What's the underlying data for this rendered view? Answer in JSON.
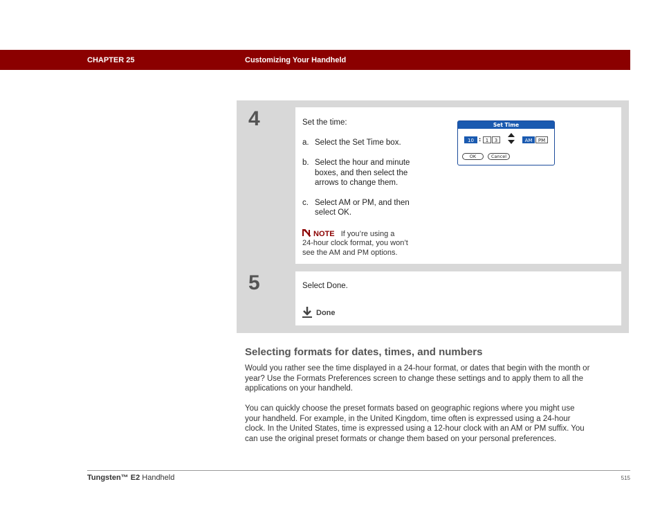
{
  "header": {
    "chapter": "CHAPTER 25",
    "title": "Customizing Your Handheld"
  },
  "step4": {
    "number": "4",
    "intro": "Set the time:",
    "a_prefix": "a.",
    "a_text": "Select the Set Time box.",
    "b_prefix": "b.",
    "b_line1": "Select the hour and minute",
    "b_line2": "boxes, and then select the",
    "b_line3": "arrows to change them.",
    "c_prefix": "c.",
    "c_line1": "Select AM or PM, and then",
    "c_line2": "select OK.",
    "note_label": "NOTE",
    "note_line1": "If you’re using a",
    "note_line2": "24-hour clock format, you won’t",
    "note_line3": "see the AM and PM options.",
    "dialog": {
      "title": "Set Time",
      "hour": "10",
      "separator": ":",
      "minute_tens": "1",
      "minute_ones": "3",
      "am": "AM",
      "pm": "PM",
      "ok": "OK",
      "cancel": "Cancel"
    }
  },
  "step5": {
    "number": "5",
    "text": "Select Done.",
    "done_label": "Done"
  },
  "section": {
    "title": "Selecting formats for dates, times, and numbers",
    "p1_l1": "Would you rather see the time displayed in a 24-hour format, or dates that begin with the month or",
    "p1_l2": "year? Use the Formats Preferences screen to change these settings and to apply them to all the",
    "p1_l3": "applications on your handheld.",
    "p2_l1": "You can quickly choose the preset formats based on geographic regions where you might use",
    "p2_l2": "your handheld. For example, in the United Kingdom, time often is expressed using a 24-hour",
    "p2_l3": "clock. In the United States, time is expressed using a 12-hour clock with an AM or PM suffix. You",
    "p2_l4": "can use the original preset formats or change them based on your personal preferences."
  },
  "footer": {
    "brand": "Tungsten™ E2",
    "product": " Handheld",
    "page": "515"
  },
  "colors": {
    "header_bg": "#8b0000",
    "dialog_blue": "#1a5ab0",
    "step_panel": "#d8d8d8"
  }
}
